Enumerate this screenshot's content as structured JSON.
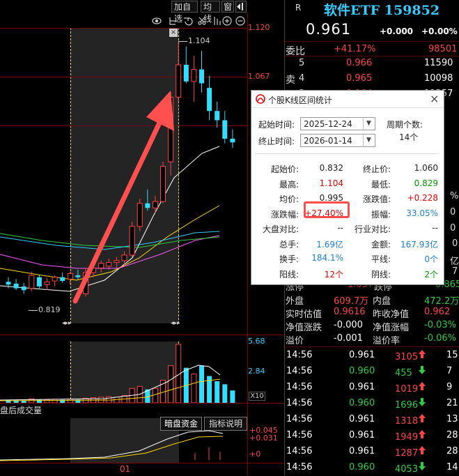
{
  "toolbar": {
    "add_watch": "加自选",
    "ma_line": "均线",
    "window": "窗"
  },
  "price_axis": [
    "1.120",
    "1.067"
  ],
  "annotations": {
    "high": "1.104",
    "low": "0.819"
  },
  "volume_axis": [
    "5.68",
    "2.84",
    "X10"
  ],
  "subchart": {
    "title": "盘后成交量",
    "btn_dark_fund": "暗盘资金",
    "btn_indicator": "指标说明",
    "axis": [
      "+0.045",
      "+0.031",
      "+0"
    ],
    "date_label": "01"
  },
  "header": {
    "r_label": "R",
    "name": "软件ETF 159852",
    "price": "0.961",
    "change": "+0.000",
    "change_pct": "+0.00%"
  },
  "weibi": {
    "label": "委比",
    "pct": "+41.17%",
    "diff": "98501"
  },
  "asks": [
    {
      "level": "5",
      "price": "0.966",
      "vol": "11590"
    },
    {
      "level": "4",
      "price": "0.965",
      "vol": "10098"
    },
    {
      "level": "3",
      "price": "0.964",
      "vol": "11257"
    }
  ],
  "ask_side_label": "卖",
  "limit_row": {
    "up_label": "涨停",
    "up": "1.057",
    "down_label": "跌停",
    "down": "0.865"
  },
  "stats": [
    {
      "l1": "外盘",
      "v1": "609.7万",
      "l2": "内盘",
      "v2": "472.2万"
    },
    {
      "l1": "实时估值",
      "v1": "0.9616",
      "l2": "昨收净值",
      "v2": "0.962"
    },
    {
      "l1": "净值涨跌",
      "v1": "-0.000",
      "l2": "净值涨幅",
      "v2": "-0.03%"
    },
    {
      "l1": "溢价",
      "v1": "-0.001",
      "l2": "溢价率",
      "v2": "-0.06%"
    }
  ],
  "side_partial": [
    "%",
    "0",
    "0",
    "亿",
    "7",
    "0"
  ],
  "ticks": [
    {
      "time": "14:56",
      "price": "0.961",
      "vol": "3105",
      "dir": "up",
      "num": "15"
    },
    {
      "time": "14:56",
      "price": "0.960",
      "vol": "455",
      "dir": "down",
      "num": "7"
    },
    {
      "time": "14:56",
      "price": "0.961",
      "vol": "1019",
      "dir": "up",
      "num": "9"
    },
    {
      "time": "14:56",
      "price": "0.960",
      "vol": "1696",
      "dir": "down",
      "num": "21"
    },
    {
      "time": "14:56",
      "price": "0.961",
      "vol": "1318",
      "dir": "up",
      "num": "13"
    },
    {
      "time": "14:56",
      "price": "0.961",
      "vol": "1949",
      "dir": "up",
      "num": "28"
    },
    {
      "time": "14:56",
      "price": "0.961",
      "vol": "1287",
      "dir": "up",
      "num": "28"
    },
    {
      "time": "14:56",
      "price": "0.960",
      "vol": "4053",
      "dir": "down",
      "num": "14"
    }
  ],
  "dialog": {
    "title": "个股K线区间统计",
    "close": "×",
    "start_label": "起始时间:",
    "start_date": "2025-12-24",
    "end_label": "终止时间:",
    "end_date": "2026-01-14",
    "period_label": "周期个数:",
    "period_value": "14个",
    "rows": [
      {
        "l1": "起始价:",
        "v1": "0.832",
        "c1": "#222",
        "l2": "终止价:",
        "v2": "1.060",
        "c2": "#222"
      },
      {
        "l1": "最高:",
        "v1": "1.104",
        "c1": "#e60000",
        "l2": "最低:",
        "v2": "0.829",
        "c2": "#009900"
      },
      {
        "l1": "均价:",
        "v1": "0.995",
        "c1": "#222",
        "l2": "涨跌值:",
        "v2": "+0.228",
        "c2": "#e60000"
      },
      {
        "l1": "涨跌幅:",
        "v1": "+27.40%",
        "c1": "#e60000",
        "l2": "振幅:",
        "v2": "33.05%",
        "c2": "#1a7fd6"
      },
      {
        "l1": "大盘对比:",
        "v1": "--",
        "c1": "#222",
        "l2": "行业对比:",
        "v2": "--",
        "c2": "#222"
      },
      {
        "l1": "总手:",
        "v1": "1.69亿",
        "c1": "#1a7fd6",
        "l2": "金额:",
        "v2": "167.93亿",
        "c2": "#1a7fd6"
      },
      {
        "l1": "换手:",
        "v1": "184.1%",
        "c1": "#1a7fd6",
        "l2": "平线:",
        "v2": "0个",
        "c2": "#1a7fd6"
      },
      {
        "l1": "阳线:",
        "v1": "12个",
        "c1": "#e60000",
        "l2": "阴线:",
        "v2": "2个",
        "c2": "#009900"
      }
    ]
  },
  "candles": [
    {
      "o": 0.845,
      "h": 0.85,
      "l": 0.838,
      "c": 0.842
    },
    {
      "o": 0.843,
      "h": 0.848,
      "l": 0.836,
      "c": 0.838
    },
    {
      "o": 0.84,
      "h": 0.844,
      "l": 0.832,
      "c": 0.836
    },
    {
      "o": 0.838,
      "h": 0.856,
      "l": 0.835,
      "c": 0.852
    },
    {
      "o": 0.85,
      "h": 0.853,
      "l": 0.838,
      "c": 0.84
    },
    {
      "o": 0.842,
      "h": 0.849,
      "l": 0.836,
      "c": 0.845
    },
    {
      "o": 0.846,
      "h": 0.852,
      "l": 0.84,
      "c": 0.85
    },
    {
      "o": 0.85,
      "h": 0.855,
      "l": 0.844,
      "c": 0.846
    },
    {
      "o": 0.848,
      "h": 0.856,
      "l": 0.842,
      "c": 0.854
    },
    {
      "o": 0.852,
      "h": 0.858,
      "l": 0.848,
      "c": 0.85
    },
    {
      "o": 0.832,
      "h": 0.86,
      "l": 0.829,
      "c": 0.855
    },
    {
      "o": 0.855,
      "h": 0.864,
      "l": 0.85,
      "c": 0.86
    },
    {
      "o": 0.86,
      "h": 0.868,
      "l": 0.855,
      "c": 0.865
    },
    {
      "o": 0.862,
      "h": 0.87,
      "l": 0.858,
      "c": 0.866
    },
    {
      "o": 0.866,
      "h": 0.872,
      "l": 0.86,
      "c": 0.868
    },
    {
      "o": 0.868,
      "h": 0.878,
      "l": 0.862,
      "c": 0.874
    },
    {
      "o": 0.874,
      "h": 0.91,
      "l": 0.872,
      "c": 0.905
    },
    {
      "o": 0.905,
      "h": 0.935,
      "l": 0.9,
      "c": 0.93
    },
    {
      "o": 0.93,
      "h": 0.945,
      "l": 0.922,
      "c": 0.925
    },
    {
      "o": 0.925,
      "h": 0.938,
      "l": 0.92,
      "c": 0.932
    },
    {
      "o": 0.932,
      "h": 0.975,
      "l": 0.93,
      "c": 0.97
    },
    {
      "o": 0.975,
      "h": 1.05,
      "l": 0.96,
      "c": 1.045
    },
    {
      "o": 1.045,
      "h": 1.104,
      "l": 1.04,
      "c": 1.08
    },
    {
      "o": 1.08,
      "h": 1.1,
      "l": 1.06,
      "c": 1.062
    },
    {
      "o": 1.062,
      "h": 1.09,
      "l": 1.04,
      "c": 1.075
    },
    {
      "o": 1.075,
      "h": 1.095,
      "l": 1.05,
      "c": 1.06
    },
    {
      "o": 1.055,
      "h": 1.068,
      "l": 1.02,
      "c": 1.03
    },
    {
      "o": 1.03,
      "h": 1.04,
      "l": 1.012,
      "c": 1.02
    },
    {
      "o": 1.02,
      "h": 1.03,
      "l": 0.995,
      "c": 1.0
    },
    {
      "o": 1.0,
      "h": 1.01,
      "l": 0.99,
      "c": 0.996
    }
  ],
  "volumes": [
    0.3,
    0.25,
    0.2,
    0.4,
    0.3,
    0.3,
    0.35,
    0.3,
    0.35,
    0.3,
    0.45,
    0.5,
    0.55,
    0.6,
    0.55,
    0.7,
    1.4,
    1.6,
    1.3,
    1.4,
    2.2,
    3.6,
    5.68,
    3.4,
    2.8,
    3.6,
    2.6,
    2.1,
    1.8,
    1.2
  ]
}
